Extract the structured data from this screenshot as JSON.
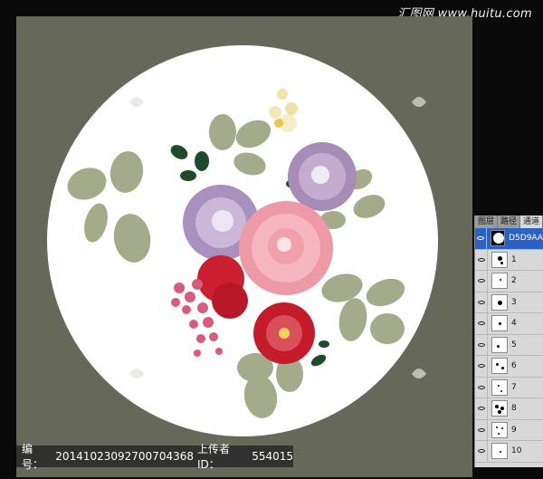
{
  "watermark": "汇图网 www.huitu.com",
  "info_bar": {
    "label": "编号：",
    "id": "20141023092700704368",
    "uploader_label": "上传者ID：",
    "uploader_id": "554015"
  },
  "layers_panel": {
    "tabs": [
      "图层",
      "路径",
      "通道"
    ],
    "active_tab": "通道",
    "channels": [
      {
        "name": "D5D9AA",
        "selected": true
      },
      {
        "name": "1",
        "selected": false
      },
      {
        "name": "2",
        "selected": false
      },
      {
        "name": "3",
        "selected": false
      },
      {
        "name": "4",
        "selected": false
      },
      {
        "name": "5",
        "selected": false
      },
      {
        "name": "6",
        "selected": false
      },
      {
        "name": "7",
        "selected": false
      },
      {
        "name": "8",
        "selected": false
      },
      {
        "name": "9",
        "selected": false
      },
      {
        "name": "10",
        "selected": false
      }
    ]
  },
  "colors": {
    "canvas_bg": "#66695a",
    "selection_blue": "#2c62c6"
  }
}
